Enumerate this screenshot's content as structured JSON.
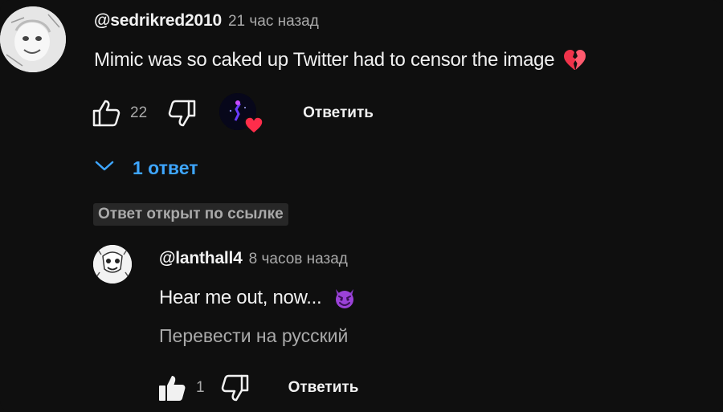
{
  "comment": {
    "author": "@sedrikred2010",
    "time": "21 час назад",
    "text": "Mimic was so caked up Twitter had to censor the image",
    "emoji": "broken-heart-emoji",
    "likes": "22",
    "reply_label": "Ответить",
    "creator_heart_icon": "creator-heart-icon"
  },
  "replies_toggle": {
    "label": "1 ответ",
    "icon": "chevron-down-icon"
  },
  "link_badge": "Ответ открыт по ссылке",
  "reply": {
    "author": "@lanthall4",
    "time": "8 часов назад",
    "text": "Hear me out, now...",
    "emoji": "smiling-imp-emoji",
    "translate_label": "Перевести на русский",
    "likes": "1",
    "reply_label": "Ответить",
    "like_state": "liked"
  },
  "colors": {
    "background": "#0f0f0f",
    "text": "#f1f1f1",
    "secondary_text": "#aaaaaa",
    "link_blue": "#3ea6ff",
    "badge_bg": "#272727",
    "heart_red": "#ff2d4b",
    "emoji_purple": "#9b42d8"
  }
}
